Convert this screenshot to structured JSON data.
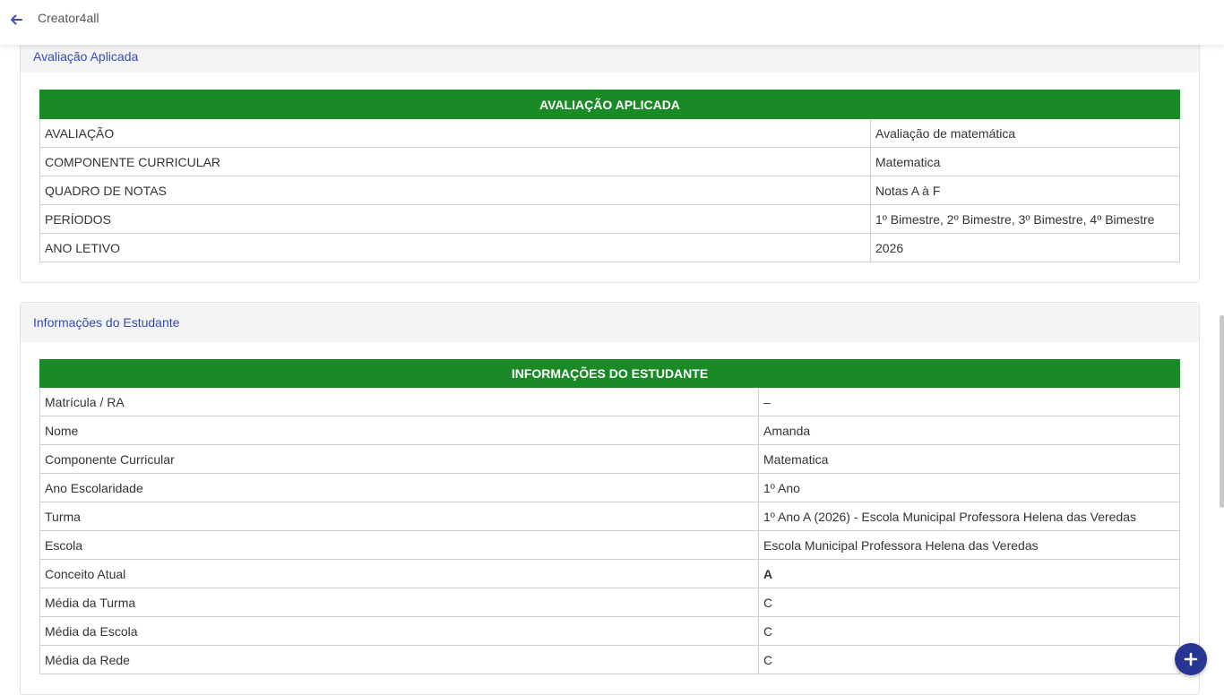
{
  "app": {
    "title": "Creator4all"
  },
  "icons": {
    "back": "arrow-left-icon",
    "fab": "plus-icon"
  },
  "colors": {
    "table_header_bg": "#1a8a27",
    "section_title": "#3949ab",
    "fab_bg": "#283593"
  },
  "section_evaluation": {
    "title": "Avaliação Aplicada",
    "table_header": "AVALIAÇÃO APLICADA",
    "rows": [
      {
        "label": "AVALIAÇÃO",
        "value": "Avaliação de matemática"
      },
      {
        "label": "COMPONENTE CURRICULAR",
        "value": "Matematica"
      },
      {
        "label": "QUADRO DE NOTAS",
        "value": "Notas A à F"
      },
      {
        "label": "PERÍODOS",
        "value": "1º Bimestre, 2º Bimestre, 3º Bimestre, 4º Bimestre"
      },
      {
        "label": "ANO LETIVO",
        "value": "2026"
      }
    ]
  },
  "section_student": {
    "title": "Informações do Estudante",
    "table_header": "INFORMAÇÕES DO ESTUDANTE",
    "rows": [
      {
        "label": "Matrícula / RA",
        "value": "–"
      },
      {
        "label": "Nome",
        "value": "Amanda"
      },
      {
        "label": "Componente Curricular",
        "value": "Matematica"
      },
      {
        "label": "Ano Escolaridade",
        "value": "1º Ano"
      },
      {
        "label": "Turma",
        "value": "1º Ano A (2026) - Escola Municipal Professora Helena das Veredas"
      },
      {
        "label": "Escola",
        "value": "Escola Municipal Professora Helena das Veredas"
      },
      {
        "label": "Conceito Atual",
        "value": "A"
      },
      {
        "label": "Média da Turma",
        "value": "C"
      },
      {
        "label": "Média da Escola",
        "value": "C"
      },
      {
        "label": "Média da Rede",
        "value": "C"
      }
    ]
  }
}
